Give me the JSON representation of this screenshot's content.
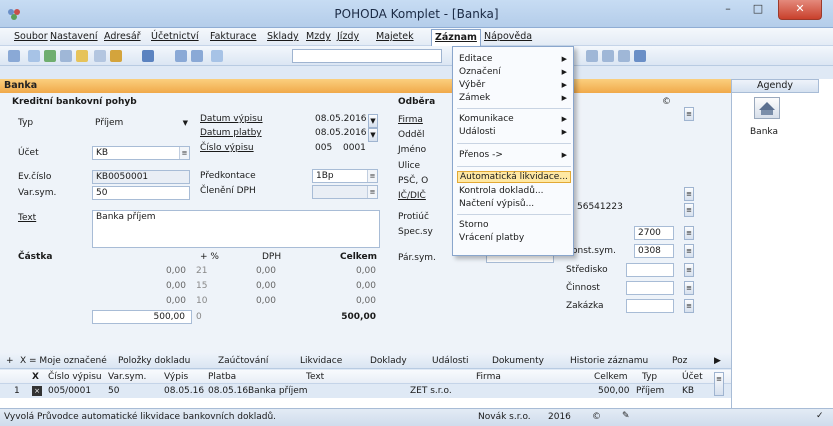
{
  "window": {
    "title": "POHODA Komplet - [Banka]"
  },
  "menubar": [
    "Soubor",
    "Nastavení",
    "Adresář",
    "Účetnictví",
    "Fakturace",
    "Sklady",
    "Mzdy",
    "Jízdy",
    "Majetek",
    "Záznam",
    "Nápověda"
  ],
  "zaznam_menu": {
    "items": [
      {
        "label": "Editace",
        "submenu": true
      },
      {
        "label": "Označení",
        "submenu": true
      },
      {
        "label": "Výběr",
        "submenu": true
      },
      {
        "label": "Zámek",
        "submenu": true
      },
      {
        "label": "Komunikace",
        "submenu": true
      },
      {
        "label": "Události",
        "submenu": true
      },
      {
        "label": "Přenos ->",
        "submenu": true
      },
      {
        "label": "Automatická likvidace...",
        "highlighted": true
      },
      {
        "label": "Kontrola dokladů..."
      },
      {
        "label": "Načtení výpisů..."
      },
      {
        "label": "Storno"
      },
      {
        "label": "Vrácení platby"
      }
    ]
  },
  "section_title": "Banka",
  "form": {
    "group_title": "Kreditní bankovní pohyb",
    "typ_label": "Typ",
    "typ_value": "Příjem",
    "ucet_label": "Účet",
    "ucet_value": "KB",
    "evcislo_label": "Ev.číslo",
    "evcislo_value": "KB0050001",
    "varsym_label": "Var.sym.",
    "varsym_value": "50",
    "text_label": "Text",
    "text_value": "Banka příjem",
    "datum_vypisu_label": "Datum výpisu",
    "datum_vypisu_value": "08.05.2016",
    "datum_platby_label": "Datum platby",
    "datum_platby_value": "08.05.2016",
    "cislo_vypisu_label": "Číslo výpisu",
    "cislo_vypisu_a": "005",
    "cislo_vypisu_b": "0001",
    "predkontace_label": "Předkontace",
    "predkontace_value": "1Bp",
    "cleneni_label": "Členění DPH",
    "castka_label": "Částka",
    "hdr_pct": "+ %",
    "hdr_dph": "DPH",
    "hdr_celkem": "Celkem",
    "rows": [
      {
        "base": "0,00",
        "pct": "21",
        "dph": "0,00",
        "celkem": "0,00"
      },
      {
        "base": "0,00",
        "pct": "15",
        "dph": "0,00",
        "celkem": "0,00"
      },
      {
        "base": "0,00",
        "pct": "10",
        "dph": "0,00",
        "celkem": "0,00"
      },
      {
        "base": "500,00",
        "pct": "0",
        "dph": "",
        "celkem": "500,00"
      }
    ],
    "odberatel_label": "Odběra",
    "firma_label": "Firma",
    "oddeleni_label": "Odděl",
    "jmeno_label": "Jméno",
    "ulice_label": "Ulice",
    "psc_label": "PSČ, O",
    "ic_label": "IČ/DIČ",
    "ic_value": "56541223",
    "protiucet_label": "Protiúč",
    "protiucet_value": "2700",
    "specsym_label": "Spec.sy",
    "konstsym_label": "onst.sym.",
    "konstsym_value": "0308",
    "parsym_label": "Pár.sym.",
    "stredisko_label": "Středisko",
    "cinnost_label": "Činnost",
    "zakazka_label": "Zakázka",
    "at_symbol": "©"
  },
  "tabs": [
    "X = Moje označené",
    "Položky dokladu",
    "Zaúčtování",
    "Likvidace",
    "Doklady",
    "Události",
    "Dokumenty",
    "Historie záznamu",
    "Poz"
  ],
  "grid": {
    "headers": [
      "X",
      "Číslo výpisu",
      "Var.sym.",
      "Výpis",
      "Platba",
      "Text",
      "Firma",
      "Celkem",
      "Typ",
      "Účet"
    ],
    "rows": [
      {
        "num": "1",
        "cislo": "005/0001",
        "varsym": "50",
        "vypis": "08.05.16",
        "platba": "08.05.16",
        "text": "Banka příjem",
        "firma": "ZET s.r.o.",
        "celkem": "500,00",
        "typ": "Příjem",
        "ucet": "KB"
      }
    ]
  },
  "status": {
    "text": "Vyvolá Průvodce automatické likvidace bankovních dokladů.",
    "user": "Novák s.r.o.",
    "year": "2016"
  },
  "agenda": {
    "header": "Agendy",
    "item": "Banka"
  },
  "colors": {
    "section": "#f0a94a",
    "highlight": "#ffe8a3"
  }
}
